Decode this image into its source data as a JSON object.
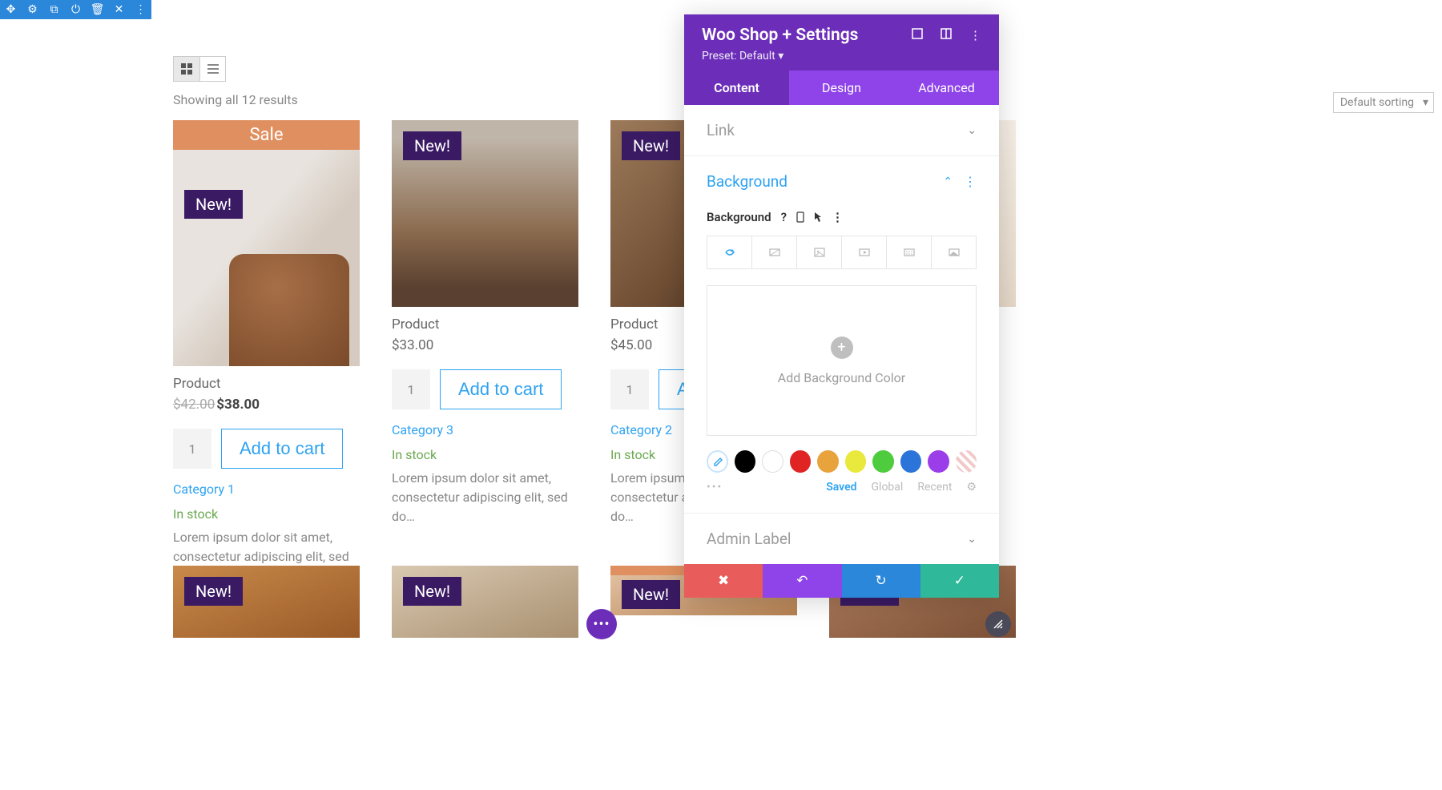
{
  "editor_toolbar": {
    "icons": [
      "move",
      "gear",
      "copy",
      "power",
      "trash",
      "close",
      "more"
    ]
  },
  "view": {
    "grid_icon": "grid",
    "list_icon": "list",
    "results_text": "Showing all 12 results",
    "sort_label": "Default sorting"
  },
  "sale_label": "Sale",
  "new_label": "New!",
  "products_row1": [
    {
      "name": "Product",
      "old_price": "$42.00",
      "price": "$38.00",
      "qty": "1",
      "add": "Add to cart",
      "category": "Category 1",
      "stock": "In stock",
      "desc": "Lorem ipsum dolor sit amet, consectetur adipiscing elit, sed do…",
      "has_sale": true
    },
    {
      "name": "Product",
      "price": "$33.00",
      "qty": "1",
      "add": "Add to cart",
      "category": "Category 3",
      "stock": "In stock",
      "desc": "Lorem ipsum dolor sit amet, consectetur adipiscing elit, sed do…"
    },
    {
      "name": "Product",
      "price": "$45.00",
      "qty": "1",
      "add": "A",
      "category": "Category 2",
      "stock": "In stock",
      "desc": "Lorem ipsum dolor sit amet, consectetur adipiscing elit, sed do…"
    },
    {
      "name": "",
      "price": "",
      "qty": "",
      "add": "",
      "category": "",
      "stock": "",
      "desc": ""
    }
  ],
  "products_row2": [
    {
      "new": true
    },
    {
      "new": true
    },
    {
      "new": true,
      "sale": true
    },
    {
      "new": true
    }
  ],
  "panel": {
    "title": "Woo Shop + Settings",
    "preset": "Preset: Default ▾",
    "header_icons": [
      "fullscreen",
      "columns",
      "more"
    ],
    "tabs": [
      "Content",
      "Design",
      "Advanced"
    ],
    "active_tab": 0,
    "sections": {
      "link": "Link",
      "background": "Background",
      "admin": "Admin Label"
    },
    "bg_label": "Background",
    "bg_label_icons": [
      "?",
      "mobile",
      "cursor",
      "more"
    ],
    "bg_type_icons": [
      "fill",
      "gradient",
      "image",
      "video",
      "pattern",
      "mask"
    ],
    "add_bg_label": "Add Background Color",
    "swatches": [
      "eyedrop",
      "#000000",
      "#ffffff",
      "#e02424",
      "#e8a33d",
      "#e8e83d",
      "#4ecc3d",
      "#2b74d9",
      "#9b3de8",
      "none"
    ],
    "swatch_tabs": {
      "saved": "Saved",
      "global": "Global",
      "recent": "Recent"
    },
    "actions": [
      "delete",
      "undo",
      "redo",
      "confirm"
    ]
  }
}
